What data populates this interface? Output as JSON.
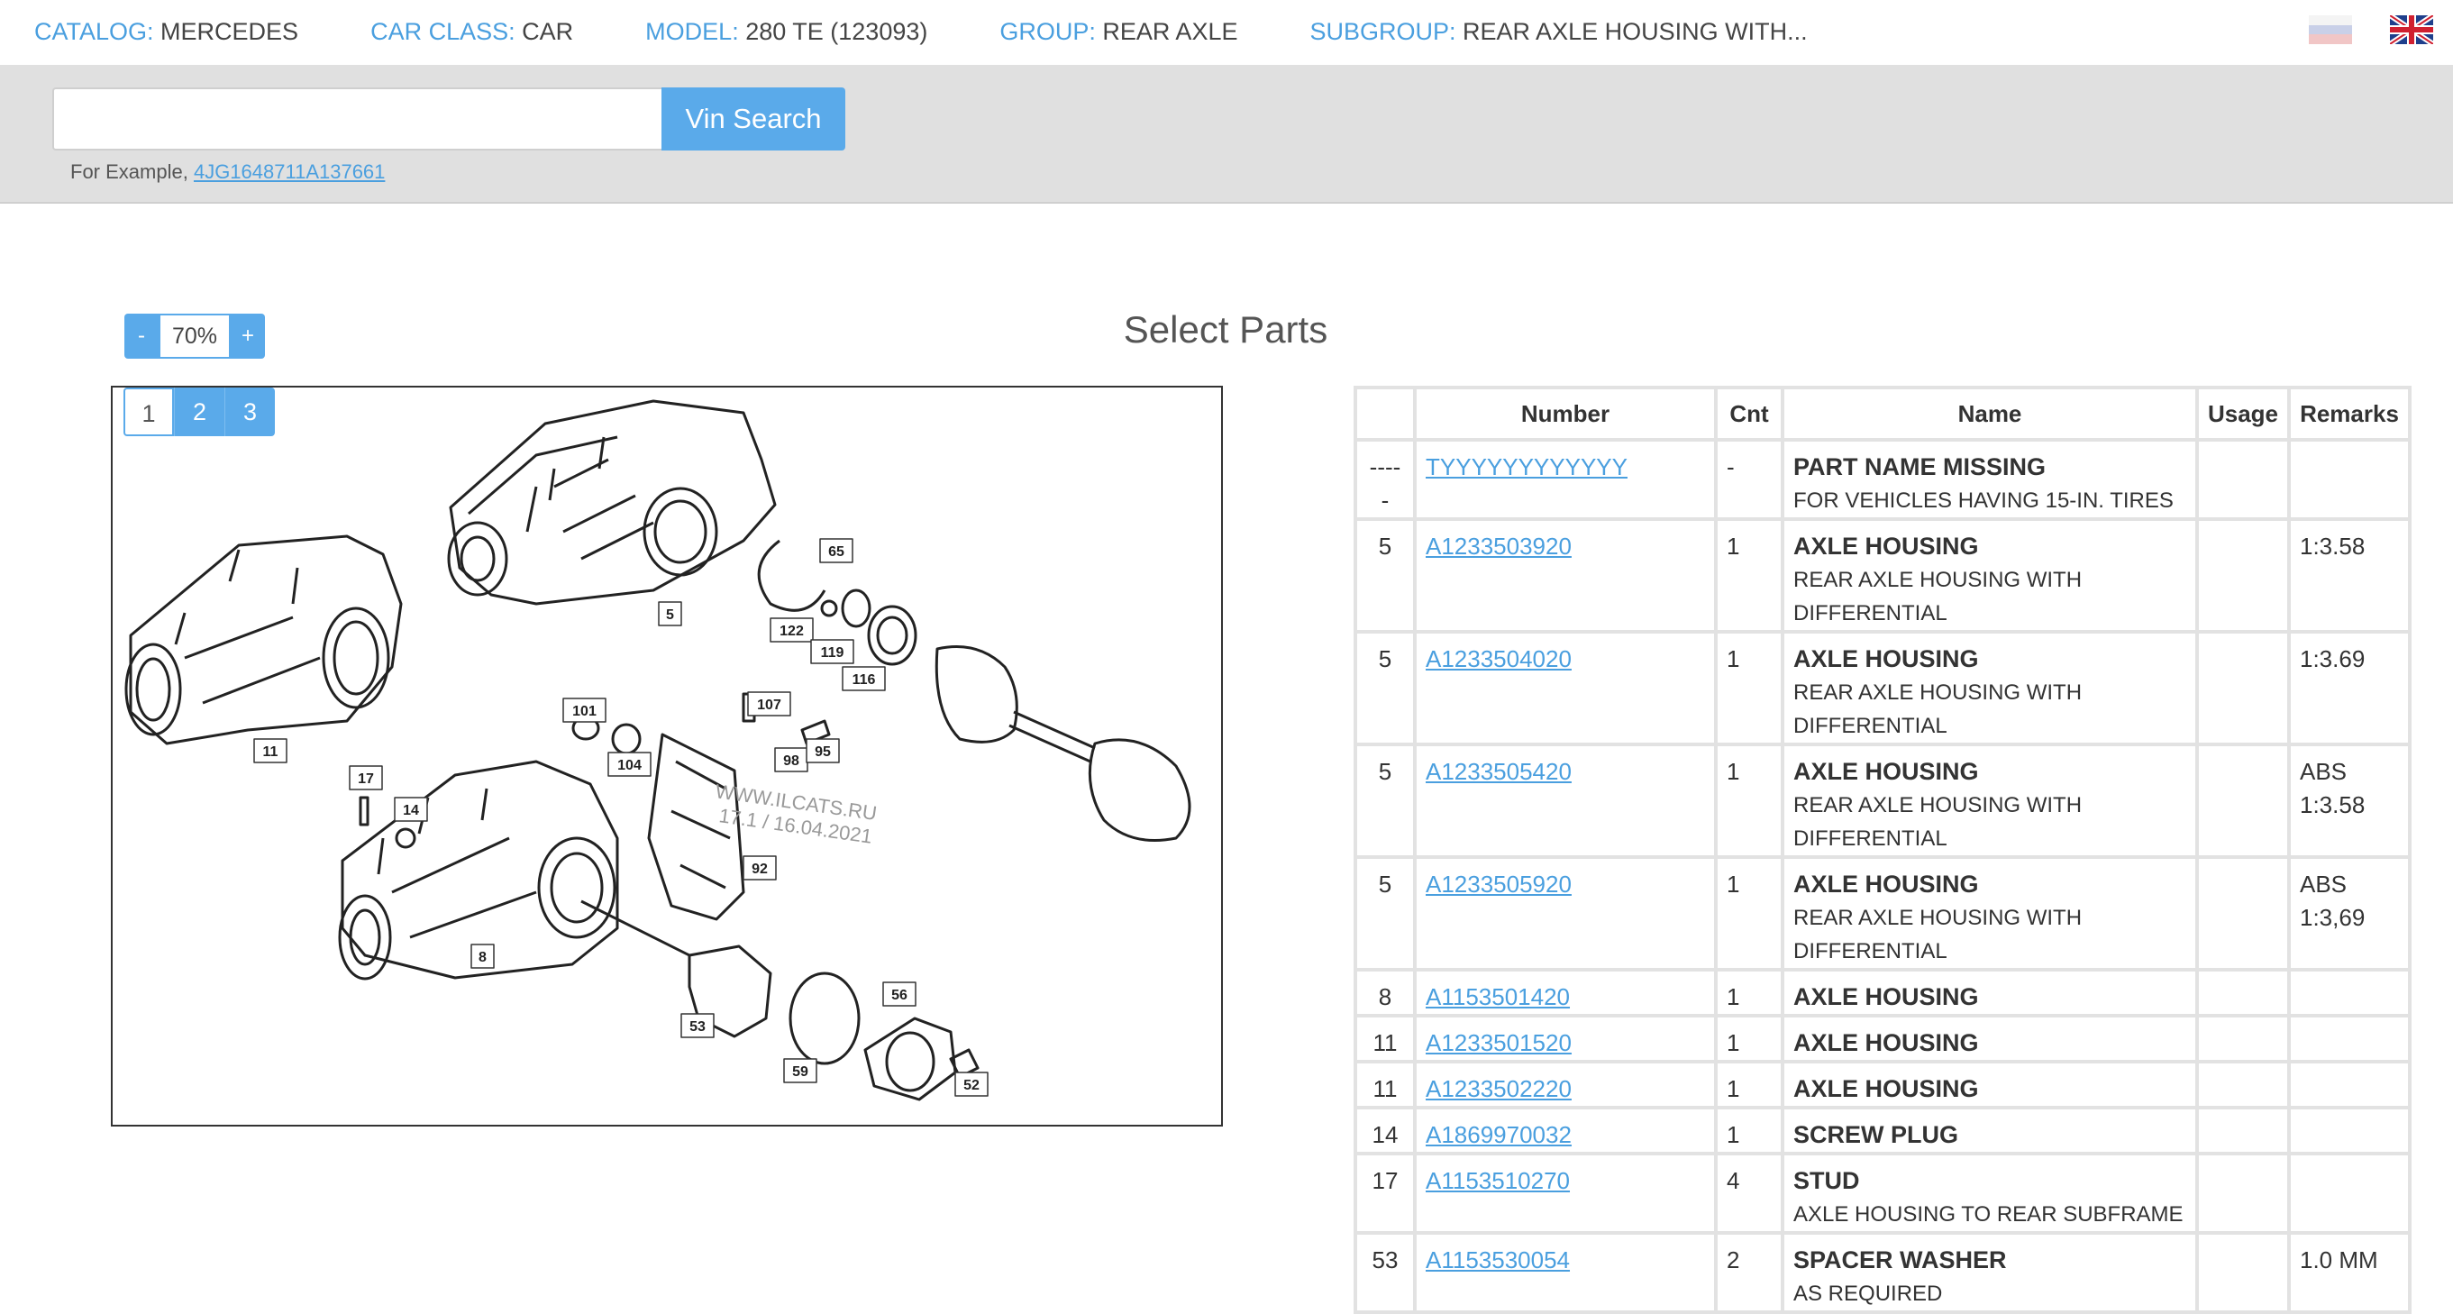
{
  "breadcrumb": [
    {
      "key": "CATALOG:",
      "value": "MERCEDES"
    },
    {
      "key": "CAR CLASS:",
      "value": "CAR"
    },
    {
      "key": "MODEL:",
      "value": "280 TE (123093)"
    },
    {
      "key": "GROUP:",
      "value": "REAR AXLE"
    },
    {
      "key": "SUBGROUP:",
      "value": "REAR AXLE HOUSING WITH..."
    }
  ],
  "flags": [
    "russian-flag-icon",
    "uk-flag-icon"
  ],
  "vin": {
    "input_value": "",
    "button_label": "Vin Search",
    "example_prefix": "For Example,",
    "example_link": "4JG1648711A137661"
  },
  "title": "Select Parts",
  "zoom": {
    "minus": "-",
    "value": "70%",
    "plus": "+"
  },
  "diagram": {
    "pages": [
      "1",
      "2",
      "3"
    ],
    "active_page": "1",
    "watermark_line1": "WWW.ILCATS.RU",
    "watermark_line2": "17.1 / 16.04.2021",
    "callouts": [
      "65",
      "5",
      "122",
      "119",
      "116",
      "11",
      "101",
      "107",
      "104",
      "98",
      "95",
      "17",
      "14",
      "92",
      "8",
      "53",
      "56",
      "59",
      "52"
    ]
  },
  "table": {
    "headers": [
      "",
      "Number",
      "Cnt",
      "Name",
      "Usage",
      "Remarks"
    ],
    "rows": [
      {
        "pos": "-----",
        "number": "TYYYYYYYYYYYY",
        "cnt": "-",
        "name": "PART NAME MISSING",
        "desc": "FOR VEHICLES HAVING 15-IN. TIRES",
        "usage": "",
        "remarks": ""
      },
      {
        "pos": "5",
        "number": "A1233503920",
        "cnt": "1",
        "name": "AXLE HOUSING",
        "desc": "REAR AXLE HOUSING WITH DIFFERENTIAL",
        "usage": "",
        "remarks": "1:3.58"
      },
      {
        "pos": "5",
        "number": "A1233504020",
        "cnt": "1",
        "name": "AXLE HOUSING",
        "desc": "REAR AXLE HOUSING WITH DIFFERENTIAL",
        "usage": "",
        "remarks": "1:3.69"
      },
      {
        "pos": "5",
        "number": "A1233505420",
        "cnt": "1",
        "name": "AXLE HOUSING",
        "desc": "REAR AXLE HOUSING WITH DIFFERENTIAL",
        "usage": "",
        "remarks": "ABS 1:3.58"
      },
      {
        "pos": "5",
        "number": "A1233505920",
        "cnt": "1",
        "name": "AXLE HOUSING",
        "desc": "REAR AXLE HOUSING WITH DIFFERENTIAL",
        "usage": "",
        "remarks": "ABS 1:3,69"
      },
      {
        "pos": "8",
        "number": "A1153501420",
        "cnt": "1",
        "name": "AXLE HOUSING",
        "desc": "",
        "usage": "",
        "remarks": ""
      },
      {
        "pos": "11",
        "number": "A1233501520",
        "cnt": "1",
        "name": "AXLE HOUSING",
        "desc": "",
        "usage": "",
        "remarks": ""
      },
      {
        "pos": "11",
        "number": "A1233502220",
        "cnt": "1",
        "name": "AXLE HOUSING",
        "desc": "",
        "usage": "",
        "remarks": ""
      },
      {
        "pos": "14",
        "number": "A1869970032",
        "cnt": "1",
        "name": "SCREW PLUG",
        "desc": "",
        "usage": "",
        "remarks": ""
      },
      {
        "pos": "17",
        "number": "A1153510270",
        "cnt": "4",
        "name": "STUD",
        "desc": "AXLE HOUSING TO REAR SUBFRAME",
        "usage": "",
        "remarks": ""
      },
      {
        "pos": "53",
        "number": "A1153530054",
        "cnt": "2",
        "name": "SPACER WASHER",
        "desc": "AS REQUIRED",
        "usage": "",
        "remarks": "1.0 MM"
      }
    ]
  },
  "colors": {
    "accent": "#5aaaea",
    "link": "#4a9fdf",
    "band": "#e0e0e0",
    "grid": "#e2e2e2"
  }
}
